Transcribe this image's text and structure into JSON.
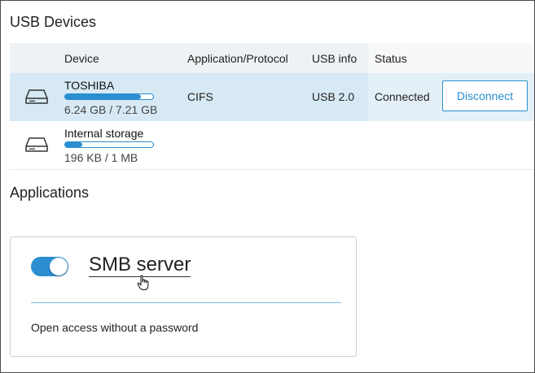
{
  "sections": {
    "usb_title": "USB Devices",
    "apps_title": "Applications"
  },
  "table": {
    "headers": {
      "device": "Device",
      "protocol": "Application/Protocol",
      "usb_info": "USB info",
      "status": "Status"
    },
    "rows": [
      {
        "name": "TOSHIBA",
        "size": "6.24 GB / 7.21 GB",
        "usage_fraction": 0.865,
        "protocol": "CIFS",
        "usb_info": "USB 2.0",
        "status": "Connected",
        "action": "Disconnect",
        "icon": "drive-icon",
        "selected": true
      },
      {
        "name": "Internal storage",
        "size": "196 KB / 1 MB",
        "usage_fraction": 0.19,
        "protocol": "",
        "usb_info": "",
        "status": "",
        "icon": "drive-icon",
        "selected": false
      }
    ]
  },
  "app": {
    "name": "SMB server",
    "enabled": true,
    "description": "Open access without a password"
  },
  "colors": {
    "accent": "#2a8ed0",
    "selected_row": "#d7e9f4",
    "header_bg": "#eef2f4"
  }
}
